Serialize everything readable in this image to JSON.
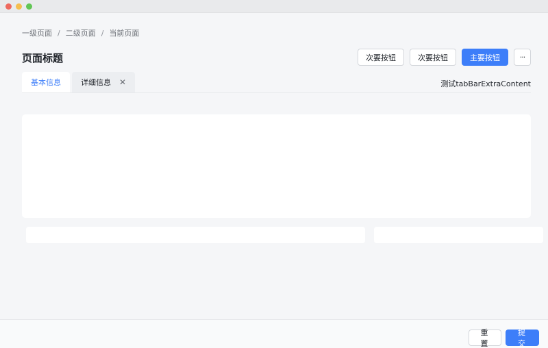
{
  "breadcrumb": {
    "items": [
      "一级页面",
      "二级页面",
      "当前页面"
    ],
    "separator": "/"
  },
  "header": {
    "title": "页面标题",
    "actions": {
      "secondary_1": "次要按钮",
      "secondary_2": "次要按钮",
      "primary": "主要按钮",
      "more": "···"
    }
  },
  "tabs": {
    "items": [
      {
        "label": "基本信息",
        "active": true
      },
      {
        "label": "详细信息",
        "closable": true,
        "close_glyph": "✕"
      }
    ],
    "extra_content": "测试tabBarExtraContent"
  },
  "footer": {
    "reset_label": "重 置",
    "submit_label": "提 交"
  },
  "colors": {
    "accent": "#3d7ef9",
    "background": "#f5f6f8",
    "card": "#ffffff"
  }
}
